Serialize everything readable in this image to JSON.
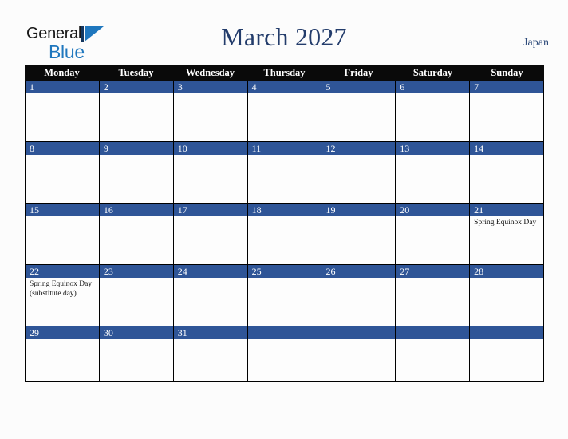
{
  "brand": {
    "word_general": "General",
    "word_blue": "Blue",
    "mark": "triangle-logo-icon",
    "color_blue": "#1f77be",
    "color_dark": "#161616"
  },
  "header": {
    "title": "March 2027",
    "region": "Japan",
    "title_color": "#233c6b"
  },
  "calendar": {
    "month": "March",
    "year": "2027",
    "weekdays": [
      "Monday",
      "Tuesday",
      "Wednesday",
      "Thursday",
      "Friday",
      "Saturday",
      "Sunday"
    ],
    "header_bg": "#0a0a0a",
    "date_bar_bg": "#2f5597",
    "cell_bg": "#fdfdfd",
    "weeks": [
      [
        {
          "day": "1",
          "event": ""
        },
        {
          "day": "2",
          "event": ""
        },
        {
          "day": "3",
          "event": ""
        },
        {
          "day": "4",
          "event": ""
        },
        {
          "day": "5",
          "event": ""
        },
        {
          "day": "6",
          "event": ""
        },
        {
          "day": "7",
          "event": ""
        }
      ],
      [
        {
          "day": "8",
          "event": ""
        },
        {
          "day": "9",
          "event": ""
        },
        {
          "day": "10",
          "event": ""
        },
        {
          "day": "11",
          "event": ""
        },
        {
          "day": "12",
          "event": ""
        },
        {
          "day": "13",
          "event": ""
        },
        {
          "day": "14",
          "event": ""
        }
      ],
      [
        {
          "day": "15",
          "event": ""
        },
        {
          "day": "16",
          "event": ""
        },
        {
          "day": "17",
          "event": ""
        },
        {
          "day": "18",
          "event": ""
        },
        {
          "day": "19",
          "event": ""
        },
        {
          "day": "20",
          "event": ""
        },
        {
          "day": "21",
          "event": "Spring Equinox Day"
        }
      ],
      [
        {
          "day": "22",
          "event": "Spring Equinox Day (substitute day)"
        },
        {
          "day": "23",
          "event": ""
        },
        {
          "day": "24",
          "event": ""
        },
        {
          "day": "25",
          "event": ""
        },
        {
          "day": "26",
          "event": ""
        },
        {
          "day": "27",
          "event": ""
        },
        {
          "day": "28",
          "event": ""
        }
      ],
      [
        {
          "day": "29",
          "event": ""
        },
        {
          "day": "30",
          "event": ""
        },
        {
          "day": "31",
          "event": ""
        },
        {
          "day": "",
          "event": ""
        },
        {
          "day": "",
          "event": ""
        },
        {
          "day": "",
          "event": ""
        },
        {
          "day": "",
          "event": ""
        }
      ]
    ]
  }
}
